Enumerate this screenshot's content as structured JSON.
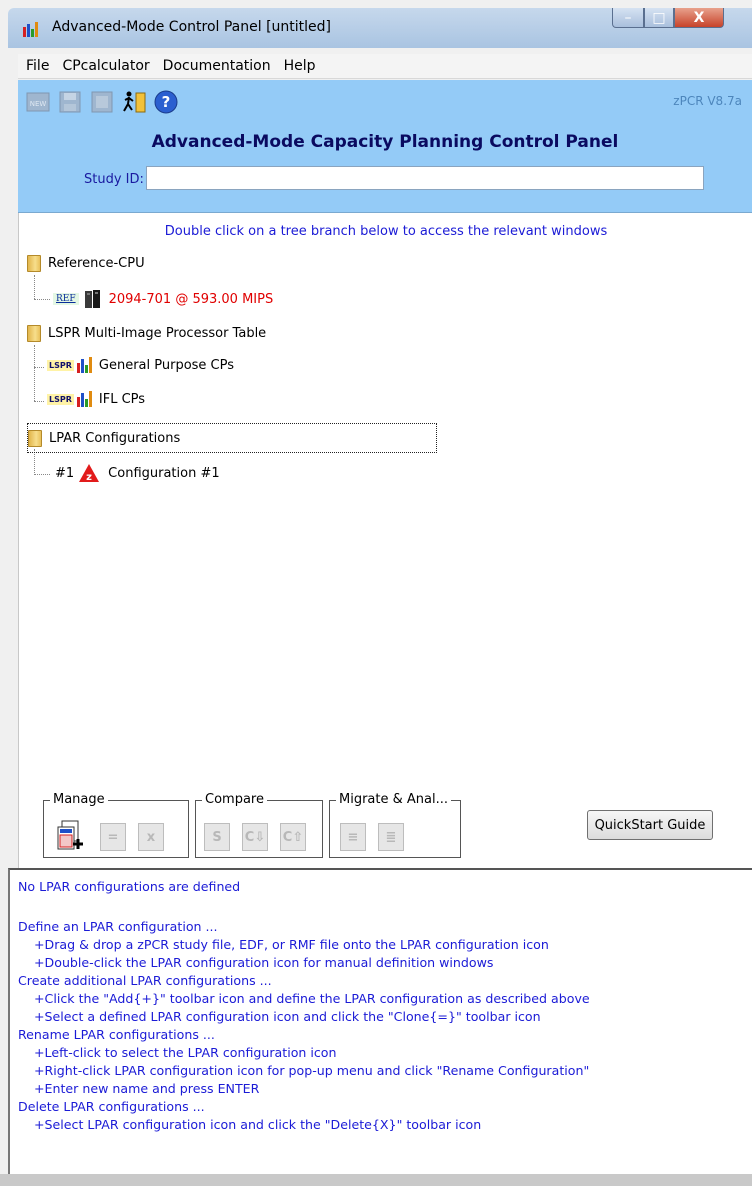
{
  "window": {
    "title": "Advanced-Mode Control Panel [untitled]",
    "minimize": "–",
    "maximize": "□",
    "close": "X"
  },
  "menu": [
    "File",
    "CPcalculator",
    "Documentation",
    "Help"
  ],
  "header": {
    "version": "zPCR V8.7a",
    "title": "Advanced-Mode Capacity Planning Control Panel",
    "study_label": "Study ID:",
    "study_value": ""
  },
  "tree": {
    "hint": "Double click on a tree branch below to access the relevant windows",
    "reference_cpu": {
      "label": "Reference-CPU",
      "tag": "REF",
      "value": "2094-701 @ 593.00 MIPS"
    },
    "lspr": {
      "label": "LSPR Multi-Image Processor Table",
      "tag": "LSPR",
      "items": [
        "General Purpose CPs",
        "IFL CPs"
      ]
    },
    "lpar": {
      "label": "LPAR Configurations",
      "config_num": "#1",
      "config_label": "Configuration #1"
    }
  },
  "groups": {
    "manage": "Manage",
    "compare": "Compare",
    "migrate": "Migrate & Anal..."
  },
  "compare_icons": [
    "S",
    "C⇩",
    "C⇧"
  ],
  "quickstart": "QuickStart Guide",
  "messages": {
    "status": "No LPAR configurations are defined",
    "lines": [
      {
        "text": "Define an LPAR configuration ...",
        "indent": false
      },
      {
        "text": "+Drag & drop a zPCR study file, EDF, or RMF file onto the LPAR configuration icon",
        "indent": true
      },
      {
        "text": "+Double-click the LPAR configuration icon for manual definition windows",
        "indent": true
      },
      {
        "text": "Create additional LPAR configurations ...",
        "indent": false
      },
      {
        "text": "+Click the \"Add{+}\" toolbar icon and define the LPAR configuration as described above",
        "indent": true
      },
      {
        "text": "+Select a defined LPAR configuration icon and click the \"Clone{=}\" toolbar icon",
        "indent": true
      },
      {
        "text": "Rename LPAR configurations ...",
        "indent": false
      },
      {
        "text": "+Left-click to select the LPAR configuration icon",
        "indent": true
      },
      {
        "text": "+Right-click LPAR configuration icon for pop-up menu and click \"Rename Configuration\"",
        "indent": true
      },
      {
        "text": "+Enter new name and press ENTER",
        "indent": true
      },
      {
        "text": "Delete LPAR configurations ...",
        "indent": false
      },
      {
        "text": "+Select LPAR configuration icon and click the \"Delete{X}\" toolbar icon",
        "indent": true
      }
    ]
  }
}
